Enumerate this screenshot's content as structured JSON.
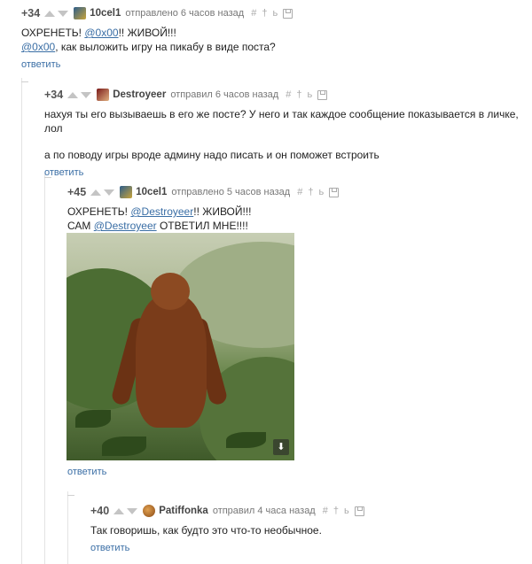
{
  "comments": [
    {
      "rating": "+34",
      "author": "10cel1",
      "time": "отправлено 6 часов назад",
      "line1": {
        "pre": "ОХРЕНЕТЬ! ",
        "mention": "@0x00",
        "post": "!! ЖИВОЙ!!!"
      },
      "line2": {
        "mention": "@0x00",
        "post": ", как выложить игру на пикабу в виде поста?"
      },
      "reply": "ответить"
    },
    {
      "rating": "+34",
      "author": "Destroyeer",
      "time": "отправил 6 часов назад",
      "paragraph1": "нахуя ты его вызываешь в его же посте? У него и так каждое сообщение показывается в личке, лол",
      "paragraph2": "а по поводу игры вроде админу надо писать и он поможет встроить",
      "reply": "ответить"
    },
    {
      "rating": "+45",
      "author": "10cel1",
      "time": "отправлено 5 часов назад",
      "line1": {
        "pre": "ОХРЕНЕТЬ! ",
        "mention": "@Destroyeer",
        "post": "!! ЖИВОЙ!!!"
      },
      "line2": {
        "pre": "САМ ",
        "mention": "@Destroyeer",
        "post": " ОТВЕТИЛ МНЕ!!!!"
      },
      "reply": "ответить"
    },
    {
      "rating": "+40",
      "author": "Patiffonka",
      "time": "отправил 4 часа назад",
      "text": "Так говоришь, как будто это что-то необычное.",
      "reply": "ответить"
    }
  ],
  "tools": {
    "hash": "#",
    "pin": "†",
    "mark": "ь"
  },
  "icons": [
    "vote-up-icon",
    "vote-down-icon",
    "link-icon",
    "pin-icon",
    "bookmark-icon",
    "save-icon",
    "download-icon"
  ],
  "colors": {
    "link": "#3a6ea5",
    "rating": "#555555",
    "thread": "#e3e3e3"
  }
}
